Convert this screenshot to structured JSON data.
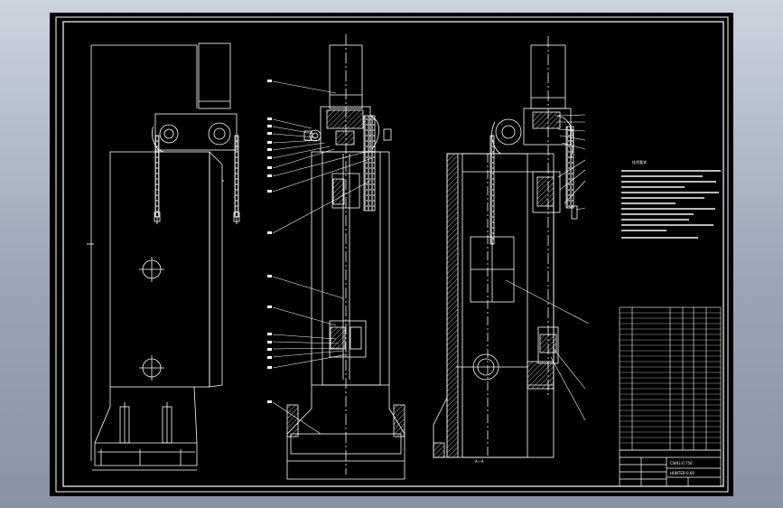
{
  "drawing": {
    "section_label": "A—A",
    "notes_title": "技术要求",
    "drawing_title_block": {
      "part_no_1": "CWXL-0.750",
      "part_no_2": "HUNTER-0.60"
    }
  },
  "colors": {
    "background_top": "#cbd3de",
    "background_bottom": "#8893a4",
    "sheet": "#000000",
    "lines": "#ffffff",
    "hatch": "#ffffff"
  }
}
